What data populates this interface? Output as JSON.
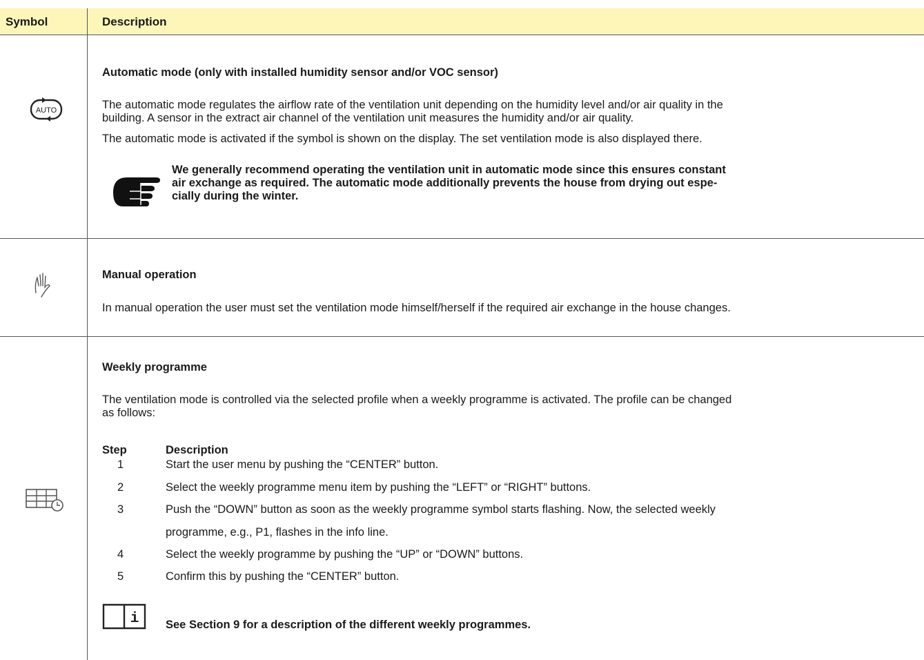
{
  "header": {
    "symbol": "Symbol",
    "description": "Description"
  },
  "auto": {
    "icon": "auto-mode-icon",
    "title": "Automatic mode (only with installed humidity sensor and/or VOC sensor)",
    "p1_l1": "The automatic mode regulates the airflow rate of the ventilation unit depending on the humidity level and/or air quality in the",
    "p1_l2": "building. A sensor in the extract air channel of the ventilation unit measures the humidity and/or air quality.",
    "p1_l3": "The automatic mode is activated if the symbol is shown on the display. The set ventilation mode is also displayed there.",
    "note_icon": "pointing-hand-icon",
    "note_l1": "We generally recommend operating the ventilation unit in automatic mode since this ensures constant",
    "note_l2": "air exchange as required. The automatic mode additionally prevents the house from drying out espe-",
    "note_l3": "cially during the winter."
  },
  "manual": {
    "icon": "manual-hand-icon",
    "title": "Manual operation",
    "text": "In manual operation the user must set the ventilation mode himself/herself if the required air exchange in the house changes."
  },
  "weekly": {
    "icon": "weekly-calendar-clock-icon",
    "title": "Weekly programme",
    "p_l1": "The ventilation mode is controlled via the selected profile when a weekly programme is activated. The profile can be changed",
    "p_l2": "as follows:",
    "step_header": "Step",
    "desc_header": "Description",
    "steps": [
      {
        "n": "1",
        "t": "Start the user menu by pushing the “CENTER” button."
      },
      {
        "n": "2",
        "t": "Select the weekly programme menu item by pushing the “LEFT” or “RIGHT” buttons."
      },
      {
        "n": "3",
        "t": "Push the “DOWN” button as soon as the weekly programme symbol starts flashing. Now, the selected weekly",
        "t2": "programme, e.g., P1, flashes in the info line."
      },
      {
        "n": "4",
        "t": "Select the weekly programme by pushing the “UP” or “DOWN” buttons."
      },
      {
        "n": "5",
        "t": "Confirm this by pushing the “CENTER” button."
      }
    ],
    "info_icon": "book-info-icon",
    "info_text": "See Section 9 for a description of the different weekly programmes."
  }
}
